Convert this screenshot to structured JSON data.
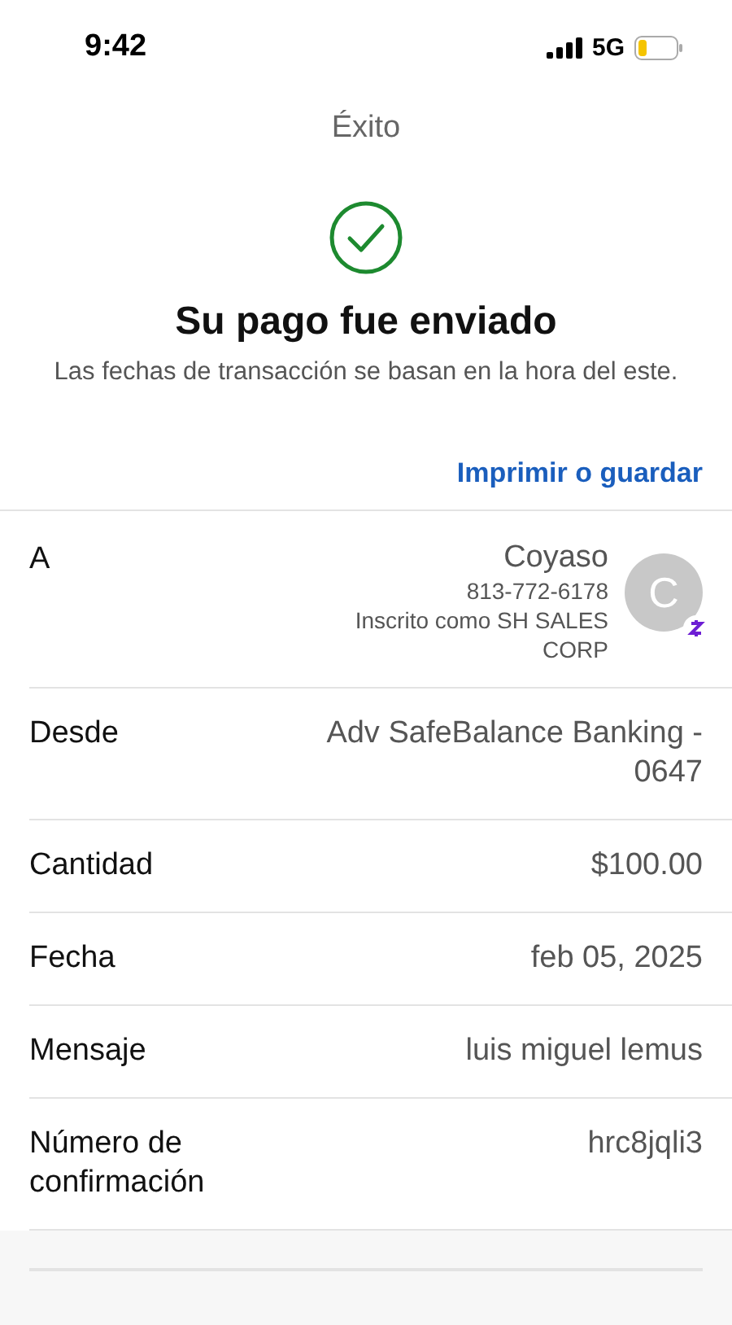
{
  "status_bar": {
    "time": "9:42",
    "network": "5G"
  },
  "title": "Éxito",
  "heading": "Su pago fue enviado",
  "subtitle": "Las fechas de transacción se basan en la hora del este.",
  "print_link": "Imprimir o guardar",
  "recipient": {
    "label": "A",
    "name": "Coyaso",
    "phone": "813-772-6178",
    "enrolled": "Inscrito como SH SALES CORP",
    "avatar_initial": "C"
  },
  "details": [
    {
      "label": "Desde",
      "value": "Adv SafeBalance Banking - 0647"
    },
    {
      "label": "Cantidad",
      "value": "$100.00"
    },
    {
      "label": "Fecha",
      "value": "feb 05, 2025"
    },
    {
      "label": "Mensaje",
      "value": "luis miguel lemus"
    },
    {
      "label": "Número de confirmación",
      "value": "hrc8jqli3"
    }
  ]
}
